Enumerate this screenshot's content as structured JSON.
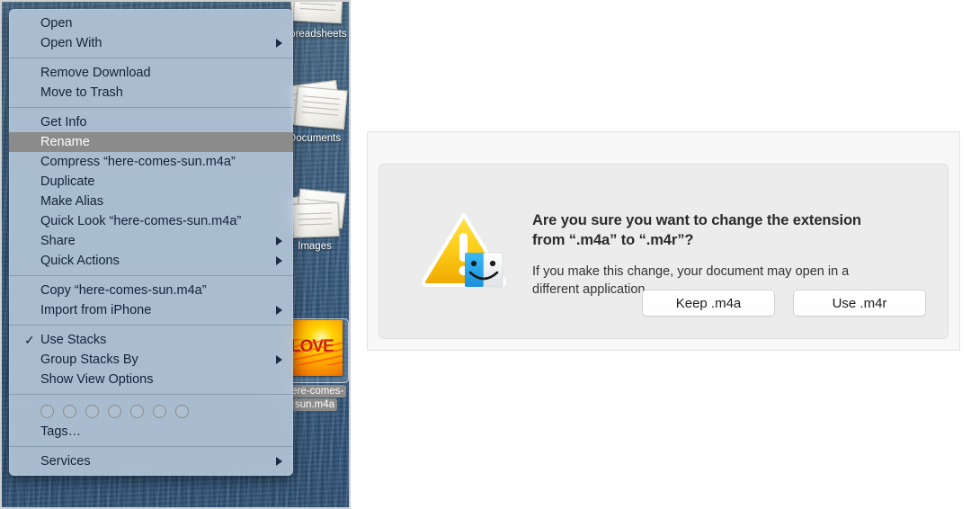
{
  "desktop": {
    "stacks": [
      {
        "label": "Spreadsheets",
        "icon": "document-stack-icon"
      },
      {
        "label": "Documents",
        "icon": "document-stack-icon"
      },
      {
        "label": "Images",
        "icon": "photo-stack-icon"
      }
    ],
    "selected_file": {
      "label_line1": "here-comes-",
      "label_line2": "sun.m4a",
      "icon": "album-artwork-icon",
      "artwork_text": "LOVE"
    }
  },
  "context_menu": {
    "groups": [
      {
        "items": [
          {
            "label": "Open",
            "submenu": false,
            "checked": false,
            "selected": false
          },
          {
            "label": "Open With",
            "submenu": true,
            "checked": false,
            "selected": false
          }
        ]
      },
      {
        "items": [
          {
            "label": "Remove Download",
            "submenu": false,
            "checked": false,
            "selected": false
          },
          {
            "label": "Move to Trash",
            "submenu": false,
            "checked": false,
            "selected": false
          }
        ]
      },
      {
        "items": [
          {
            "label": "Get Info",
            "submenu": false,
            "checked": false,
            "selected": false
          },
          {
            "label": "Rename",
            "submenu": false,
            "checked": false,
            "selected": true
          },
          {
            "label": "Compress “here-comes-sun.m4a”",
            "submenu": false,
            "checked": false,
            "selected": false
          },
          {
            "label": "Duplicate",
            "submenu": false,
            "checked": false,
            "selected": false
          },
          {
            "label": "Make Alias",
            "submenu": false,
            "checked": false,
            "selected": false
          },
          {
            "label": "Quick Look “here-comes-sun.m4a”",
            "submenu": false,
            "checked": false,
            "selected": false
          },
          {
            "label": "Share",
            "submenu": true,
            "checked": false,
            "selected": false
          },
          {
            "label": "Quick Actions",
            "submenu": true,
            "checked": false,
            "selected": false
          }
        ]
      },
      {
        "items": [
          {
            "label": "Copy “here-comes-sun.m4a”",
            "submenu": false,
            "checked": false,
            "selected": false
          },
          {
            "label": "Import from iPhone",
            "submenu": true,
            "checked": false,
            "selected": false
          }
        ]
      },
      {
        "items": [
          {
            "label": "Use Stacks",
            "submenu": false,
            "checked": true,
            "selected": false
          },
          {
            "label": "Group Stacks By",
            "submenu": true,
            "checked": false,
            "selected": false
          },
          {
            "label": "Show View Options",
            "submenu": false,
            "checked": false,
            "selected": false
          }
        ]
      },
      {
        "tags_row": true,
        "tag_count": 7,
        "items": [
          {
            "label": "Tags…",
            "submenu": false,
            "checked": false,
            "selected": false
          }
        ]
      },
      {
        "items": [
          {
            "label": "Services",
            "submenu": true,
            "checked": false,
            "selected": false
          }
        ]
      }
    ],
    "colors": {
      "background": "#b2c4d6",
      "selected_background": "#8b8b8b",
      "text": "#13233a"
    }
  },
  "dialog": {
    "icon": "warning-triangle-finder-icon",
    "title": "Are you sure you want to change the extension from “.m4a” to “.m4r”?",
    "body": "If you make this change, your document may open in a different application.",
    "buttons": [
      {
        "label": "Keep .m4a",
        "name": "keep-extension-button"
      },
      {
        "label": "Use .m4r",
        "name": "use-extension-button"
      }
    ],
    "colors": {
      "warning_yellow": "#f5c518",
      "panel": "#ececec",
      "frame": "#f7f7f7"
    }
  }
}
